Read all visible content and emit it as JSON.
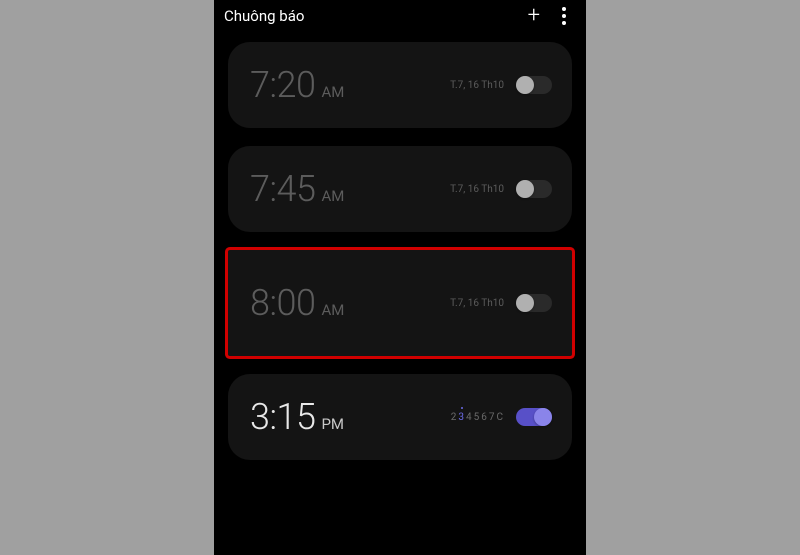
{
  "header": {
    "title": "Chuông báo"
  },
  "alarms": [
    {
      "time": "7:20",
      "period": "AM",
      "date": "T.7, 16 Th10",
      "enabled": false,
      "highlighted": false,
      "active": false
    },
    {
      "time": "7:45",
      "period": "AM",
      "date": "T.7, 16 Th10",
      "enabled": false,
      "highlighted": false,
      "active": false
    },
    {
      "time": "8:00",
      "period": "AM",
      "date": "T.7, 16 Th10",
      "enabled": false,
      "highlighted": true,
      "active": false
    },
    {
      "time": "3:15",
      "period": "PM",
      "days": [
        "2",
        "3",
        "4",
        "5",
        "6",
        "7",
        "C"
      ],
      "day_on_index": 1,
      "enabled": true,
      "highlighted": false,
      "active": true
    }
  ]
}
